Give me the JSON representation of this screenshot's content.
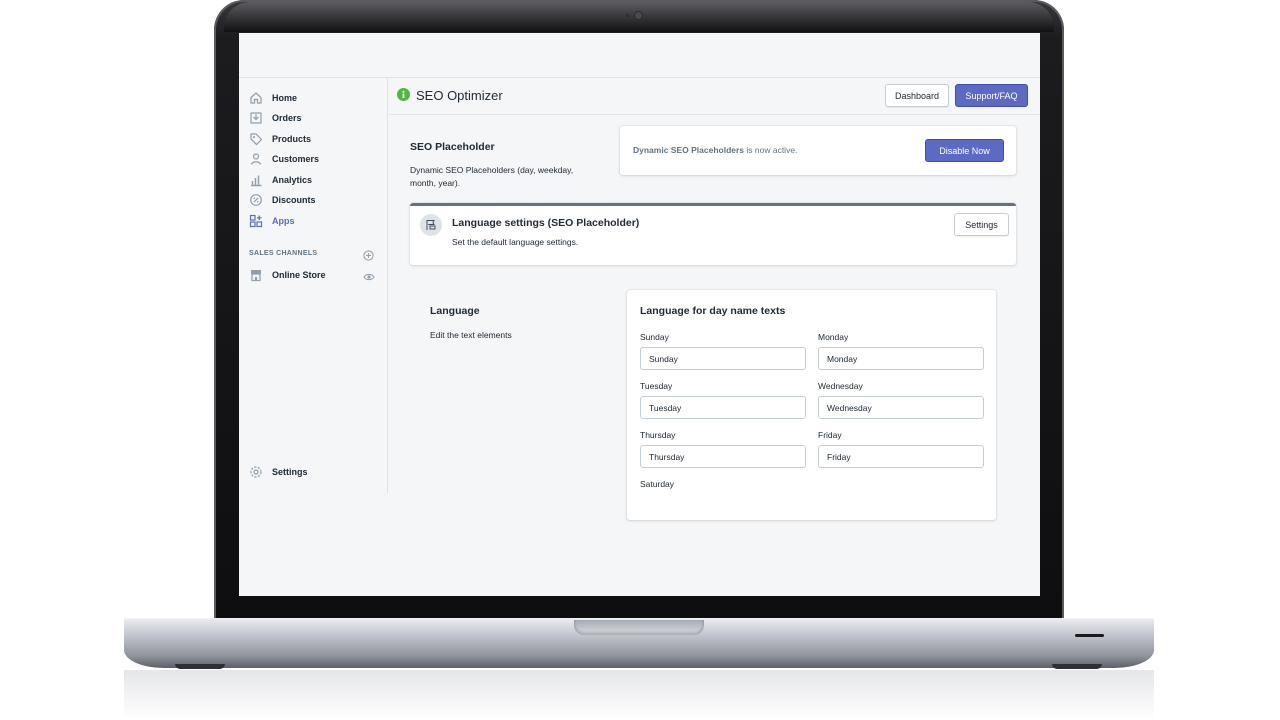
{
  "app": {
    "title": "SEO Optimizer",
    "accent": "#5c6ac4",
    "status_icon_color": "#50b83c"
  },
  "header_buttons": {
    "dashboard": "Dashboard",
    "support": "Support/FAQ"
  },
  "sidebar": {
    "items": [
      {
        "label": "Home",
        "icon": "home-icon"
      },
      {
        "label": "Orders",
        "icon": "orders-icon"
      },
      {
        "label": "Products",
        "icon": "tag-icon"
      },
      {
        "label": "Customers",
        "icon": "person-icon"
      },
      {
        "label": "Analytics",
        "icon": "bar-chart-icon"
      },
      {
        "label": "Discounts",
        "icon": "discount-icon"
      },
      {
        "label": "Apps",
        "icon": "apps-icon"
      }
    ],
    "sales_channels_title": "SALES CHANNELS",
    "online_store": "Online Store",
    "settings": "Settings"
  },
  "seo_placeholder": {
    "title": "SEO Placeholder",
    "description": "Dynamic SEO Placeholders (day, weekday, month, year).",
    "status_strong": "Dynamic SEO Placeholders",
    "status_rest": " is now active.",
    "disable_button": "Disable Now"
  },
  "language_settings": {
    "title": "Language settings (SEO Placeholder)",
    "subtitle": "Set the default language settings.",
    "button": "Settings"
  },
  "language": {
    "title": "Language",
    "description": "Edit the text elements",
    "card_title": "Language for day name texts",
    "fields": [
      {
        "label": "Sunday",
        "value": "Sunday"
      },
      {
        "label": "Monday",
        "value": "Monday"
      },
      {
        "label": "Tuesday",
        "value": "Tuesday"
      },
      {
        "label": "Wednesday",
        "value": "Wednesday"
      },
      {
        "label": "Thursday",
        "value": "Thursday"
      },
      {
        "label": "Friday",
        "value": "Friday"
      },
      {
        "label": "Saturday",
        "value": ""
      }
    ]
  }
}
